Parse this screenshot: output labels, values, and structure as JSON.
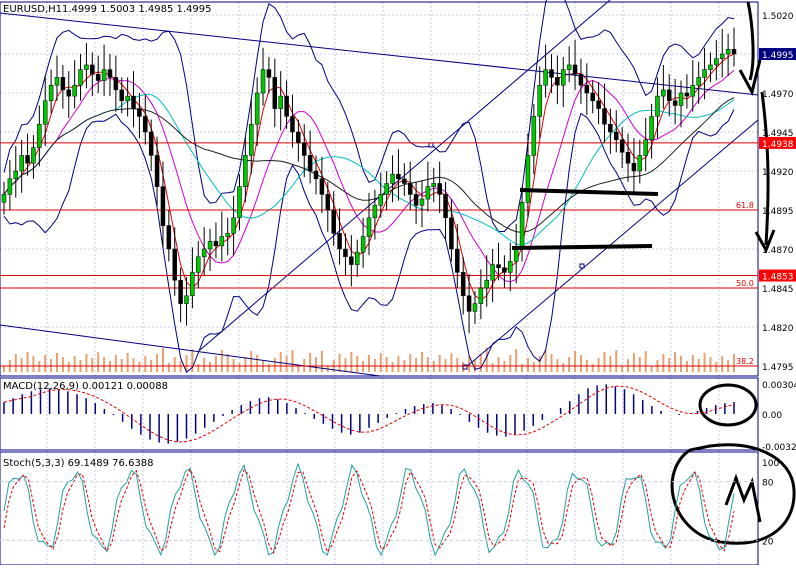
{
  "main": {
    "symbol_label": "EURUSD,H1",
    "ohlc_label": "1.4999 1.5003 1.4985 1.4995",
    "price_ticks": [
      "1.5020",
      "1.4970",
      "1.4945",
      "1.4920",
      "1.4895",
      "1.4870",
      "1.4845",
      "1.4820",
      "1.4795"
    ],
    "current_price_tag": "1.4995",
    "level_tags": [
      "1.4938",
      "1.4853"
    ],
    "fib_labels": [
      "61.8",
      "50.0",
      "38.2"
    ]
  },
  "macd": {
    "label": "MACD(12,26,9) 0.00121 0.00088",
    "ticks": [
      "0.00304",
      "0.00",
      "-0.00325"
    ]
  },
  "stoch": {
    "label": "Stoch(5,3,3) 69.1489 76.6388",
    "ticks": [
      "100",
      "80",
      "20"
    ]
  },
  "colors": {
    "background": "#ffffff",
    "grid": "#c8c8e6",
    "candle_line": "#000000",
    "bull": "#00c800",
    "bear": "#000000",
    "frame": "#000080",
    "price_tag_bg": "#000080",
    "level_line": "#e00000",
    "level_tag_bg": "#ff0000",
    "ma_red": "#e00000",
    "ma_magenta": "#d000d0",
    "ma_cyan": "#00c0c0",
    "ma_black": "#202020",
    "bollinger": "#000080",
    "volume": "#e8a070",
    "macd_hist": "#000080",
    "macd_signal": "#e00000",
    "stoch_main": "#20a0a0",
    "stoch_signal": "#e00000"
  },
  "chart_data": [
    {
      "type": "candlestick",
      "symbol": "EURUSD",
      "timeframe": "H1",
      "ylim": [
        1.478,
        1.503
      ],
      "last": {
        "open": 1.4999,
        "high": 1.5003,
        "low": 1.4985,
        "close": 1.4995
      },
      "horizontal_levels": [
        {
          "value": 1.4938,
          "label": "1.4938"
        },
        {
          "value": 1.4895,
          "label": "61.8"
        },
        {
          "value": 1.4853,
          "label": "1.4853"
        },
        {
          "value": 1.4845,
          "label": "50.0"
        },
        {
          "value": 1.4795,
          "label": "38.2"
        }
      ],
      "closes": [
        1.4905,
        1.4915,
        1.492,
        1.493,
        1.4925,
        1.4935,
        1.495,
        1.4965,
        1.4975,
        1.498,
        1.4972,
        1.4968,
        1.4975,
        1.4985,
        1.4988,
        1.4982,
        1.4978,
        1.4985,
        1.498,
        1.4972,
        1.4965,
        1.4968,
        1.496,
        1.4955,
        1.4945,
        1.493,
        1.491,
        1.4885,
        1.487,
        1.485,
        1.4835,
        1.484,
        1.4855,
        1.4865,
        1.487,
        1.4875,
        1.4872,
        1.4878,
        1.488,
        1.489,
        1.491,
        1.493,
        1.495,
        1.497,
        1.4985,
        1.498,
        1.496,
        1.4968,
        1.4955,
        1.4945,
        1.4938,
        1.493,
        1.492,
        1.4915,
        1.4905,
        1.4895,
        1.488,
        1.487,
        1.4865,
        1.486,
        1.4868,
        1.4878,
        1.489,
        1.4898,
        1.4905,
        1.4912,
        1.4918,
        1.4915,
        1.4912,
        1.4905,
        1.4898,
        1.4902,
        1.491,
        1.4912,
        1.4905,
        1.489,
        1.487,
        1.4855,
        1.484,
        1.483,
        1.4835,
        1.4845,
        1.485,
        1.486,
        1.4858,
        1.4855,
        1.4862,
        1.487,
        1.49,
        1.493,
        1.4955,
        1.4975,
        1.4985,
        1.498,
        1.4975,
        1.4985,
        1.4988,
        1.4982,
        1.4975,
        1.497,
        1.4965,
        1.496,
        1.495,
        1.4945,
        1.494,
        1.4932,
        1.4925,
        1.492,
        1.493,
        1.494,
        1.4955,
        1.4968,
        1.4972,
        1.4965,
        1.4962,
        1.497,
        1.4968,
        1.4975,
        1.498,
        1.4985,
        1.4988,
        1.4992,
        1.4995,
        1.4998,
        1.4995
      ]
    },
    {
      "type": "bar",
      "name": "MACD(12,26,9)",
      "values": [
        0.0012,
        0.0016,
        0.002,
        0.0023,
        0.0025,
        0.0026,
        0.0025,
        0.0023,
        0.002,
        0.0016,
        0.0011,
        0.0005,
        -0.0001,
        -0.0008,
        -0.0015,
        -0.0021,
        -0.0026,
        -0.0029,
        -0.003,
        -0.0028,
        -0.0025,
        -0.002,
        -0.0014,
        -0.0008,
        -0.0002,
        0.0004,
        0.0009,
        0.0013,
        0.0016,
        0.0017,
        0.0015,
        0.0011,
        0.0006,
        0.0001,
        -0.0005,
        -0.001,
        -0.0015,
        -0.0019,
        -0.0021,
        -0.0019,
        -0.0014,
        -0.0009,
        -0.0004,
        0.0001,
        0.0005,
        0.0008,
        0.001,
        0.0011,
        0.0009,
        0.0005,
        -0.0001,
        -0.0008,
        -0.0014,
        -0.0019,
        -0.0022,
        -0.0023,
        -0.0021,
        -0.0017,
        -0.0012,
        -0.0006,
        0.0,
        0.0006,
        0.0013,
        0.002,
        0.0026,
        0.0029,
        0.003,
        0.0028,
        0.0025,
        0.002,
        0.0014,
        0.0008,
        0.0003,
        0.0,
        -0.0001,
        0.0,
        0.0003,
        0.0006,
        0.0009,
        0.0011,
        0.00121
      ],
      "signal": 0.00088
    },
    {
      "type": "line",
      "name": "Stoch(5,3,3)",
      "ylim": [
        0,
        100
      ],
      "main_last": 69.1489,
      "signal_last": 76.6388
    }
  ]
}
